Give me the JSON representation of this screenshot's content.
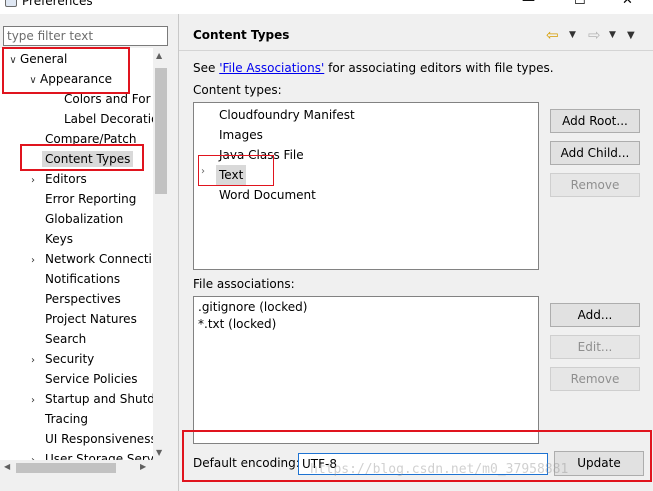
{
  "window": {
    "title": "Preferences",
    "minimize_glyph": "—",
    "maximize_glyph": "☐",
    "close_glyph": "✕"
  },
  "filter": {
    "placeholder": "type filter text",
    "value": ""
  },
  "tree": {
    "items": [
      {
        "label": "General",
        "expanded": true
      },
      {
        "label": "Appearance",
        "expanded": true
      },
      {
        "label": "Colors and For"
      },
      {
        "label": "Label Decoratio"
      },
      {
        "label": "Compare/Patch"
      },
      {
        "label": "Content Types",
        "selected": true
      },
      {
        "label": "Editors",
        "expandable": true
      },
      {
        "label": "Error Reporting"
      },
      {
        "label": "Globalization"
      },
      {
        "label": "Keys"
      },
      {
        "label": "Network Connecti",
        "expandable": true
      },
      {
        "label": "Notifications"
      },
      {
        "label": "Perspectives"
      },
      {
        "label": "Project Natures"
      },
      {
        "label": "Search"
      },
      {
        "label": "Security",
        "expandable": true
      },
      {
        "label": "Service Policies"
      },
      {
        "label": "Startup and Shutd",
        "expandable": true
      },
      {
        "label": "Tracing"
      },
      {
        "label": "UI Responsiveness"
      },
      {
        "label": "User Storage Serv",
        "expandable": true
      }
    ]
  },
  "page": {
    "title": "Content Types",
    "description_prefix": "See ",
    "description_link": "'File Associations'",
    "description_suffix": " for associating editors with file types.",
    "content_types_label": "Content types:",
    "content_types": [
      {
        "label": "Cloudfoundry Manifest"
      },
      {
        "label": "Images"
      },
      {
        "label": "Java Class File"
      },
      {
        "label": "Text",
        "selected": true,
        "expandable": true
      },
      {
        "label": "Word Document"
      }
    ],
    "buttons": {
      "add_root": "Add Root...",
      "add_child": "Add Child...",
      "remove_type": "Remove"
    },
    "file_associations_label": "File associations:",
    "file_associations": [
      ".gitignore (locked)",
      "*.txt (locked)"
    ],
    "fa_buttons": {
      "add": "Add...",
      "edit": "Edit...",
      "remove": "Remove"
    },
    "default_encoding_label": "Default encoding:",
    "default_encoding_value": "UTF-8",
    "update_label": "Update"
  },
  "watermark": "https://blog.csdn.net/m0_37958881",
  "colors": {
    "highlight_box": "#e0141e",
    "link": "#0000ee",
    "selection": "#d9d9d9",
    "nav_back_arrow": "#d69c00"
  },
  "icons": {
    "back": "back-arrow-icon",
    "forward": "forward-arrow-icon",
    "view_menu": "view-menu-icon"
  }
}
